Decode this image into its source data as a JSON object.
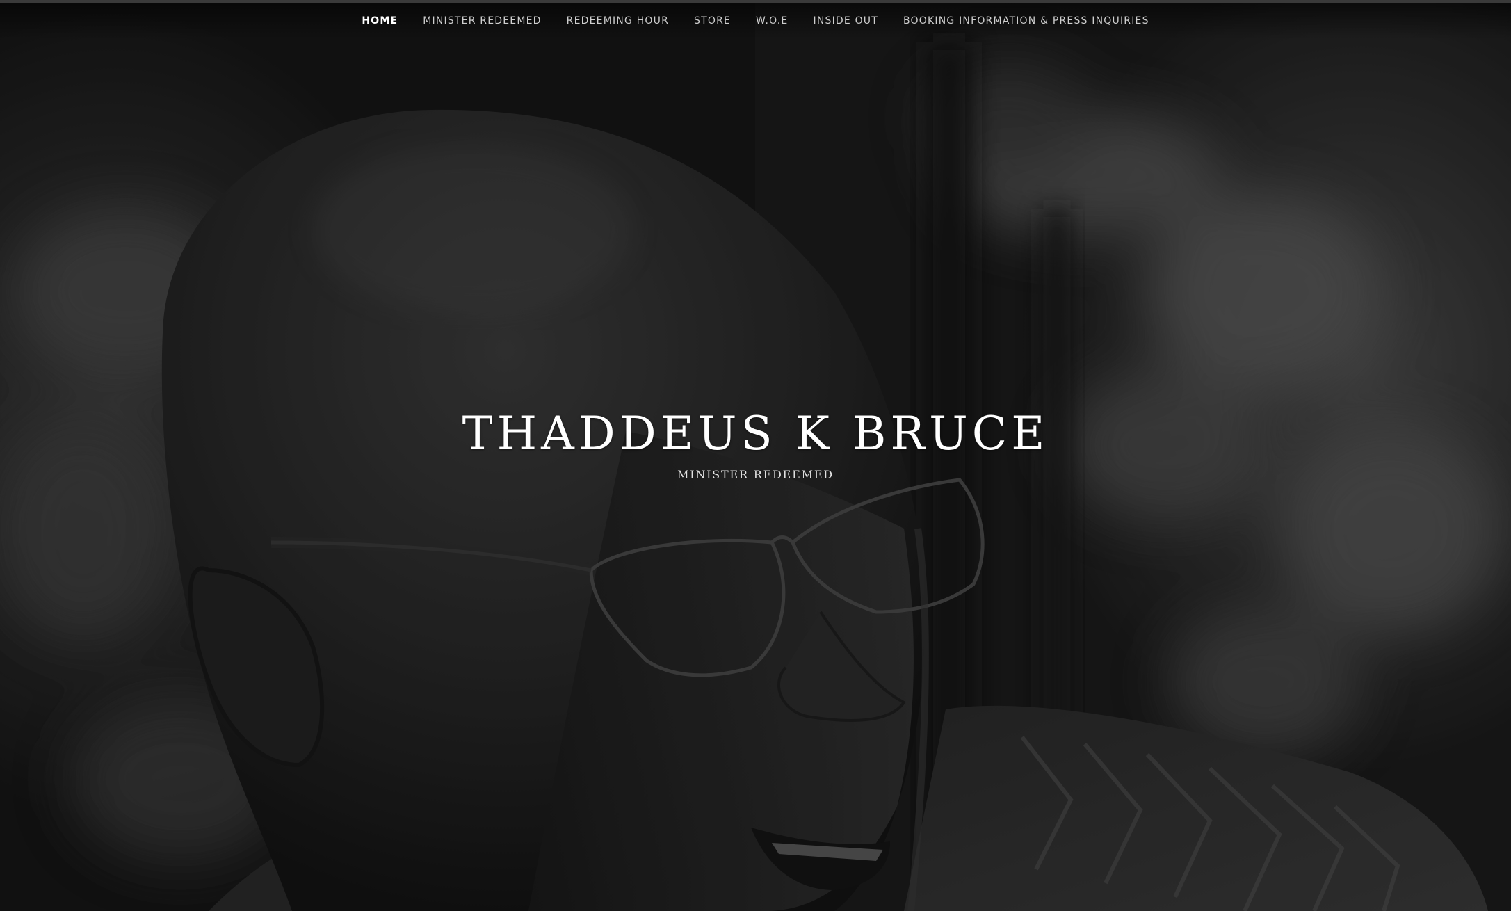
{
  "nav": {
    "items": [
      {
        "label": "HOME",
        "active": true
      },
      {
        "label": "MINISTER REDEEMED",
        "active": false
      },
      {
        "label": "REDEEMING HOUR",
        "active": false
      },
      {
        "label": "STORE",
        "active": false
      },
      {
        "label": "W.O.E",
        "active": false
      },
      {
        "label": "INSIDE OUT",
        "active": false
      },
      {
        "label": "BOOKING INFORMATION & PRESS INQUIRIES",
        "active": false
      }
    ]
  },
  "hero": {
    "title": "THADDEUS K BRUCE",
    "subtitle": "MINISTER REDEEMED"
  },
  "colors": {
    "text": "#ffffff",
    "nav_text": "#cfcfcf",
    "background": "#1c1c1c"
  }
}
